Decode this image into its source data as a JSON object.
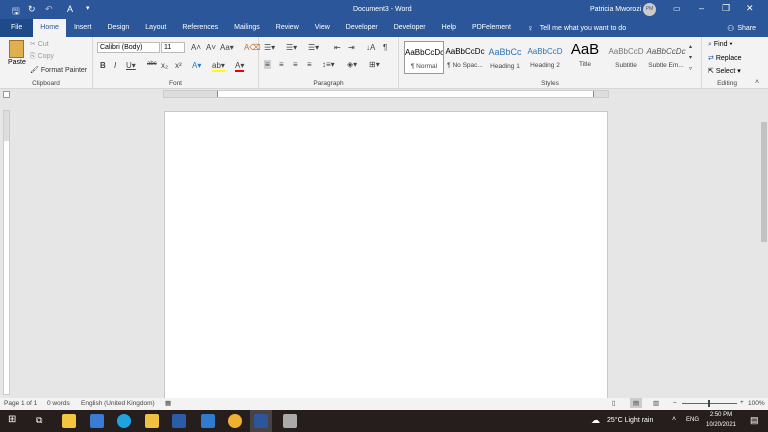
{
  "titlebar": {
    "document": "Document3 - Word",
    "user": "Patricia Mworozi",
    "initials": "PM"
  },
  "tabs": [
    "File",
    "Home",
    "Insert",
    "Design",
    "Layout",
    "References",
    "Mailings",
    "Review",
    "View",
    "Developer",
    "Developer",
    "Help",
    "PDFelement"
  ],
  "tell_me": "Tell me what you want to do",
  "share": "Share",
  "clipboard": {
    "paste": "Paste",
    "cut": "Cut",
    "copy": "Copy",
    "format_painter": "Format Painter",
    "label": "Clipboard"
  },
  "font": {
    "name": "Calibri (Body)",
    "size": "11",
    "label": "Font"
  },
  "paragraph": {
    "label": "Paragraph"
  },
  "styles": {
    "label": "Styles",
    "items": [
      {
        "preview": "AaBbCcDc",
        "name": "¶ Normal"
      },
      {
        "preview": "AaBbCcDc",
        "name": "¶ No Spac..."
      },
      {
        "preview": "AaBbCc",
        "name": "Heading 1"
      },
      {
        "preview": "AaBbCcD",
        "name": "Heading 2"
      },
      {
        "preview": "AaB",
        "name": "Title"
      },
      {
        "preview": "AaBbCcD",
        "name": "Subtitle"
      },
      {
        "preview": "AaBbCcDc",
        "name": "Subtle Em..."
      }
    ]
  },
  "editing": {
    "find": "Find",
    "replace": "Replace",
    "select": "Select",
    "label": "Editing"
  },
  "status": {
    "page": "Page 1 of 1",
    "words": "0 words",
    "language": "English (United Kingdom)",
    "zoom": "100%"
  },
  "taskbar": {
    "weather": "25°C  Light rain",
    "lang": "ENG",
    "time": "2:50 PM",
    "date": "10/20/2021"
  }
}
